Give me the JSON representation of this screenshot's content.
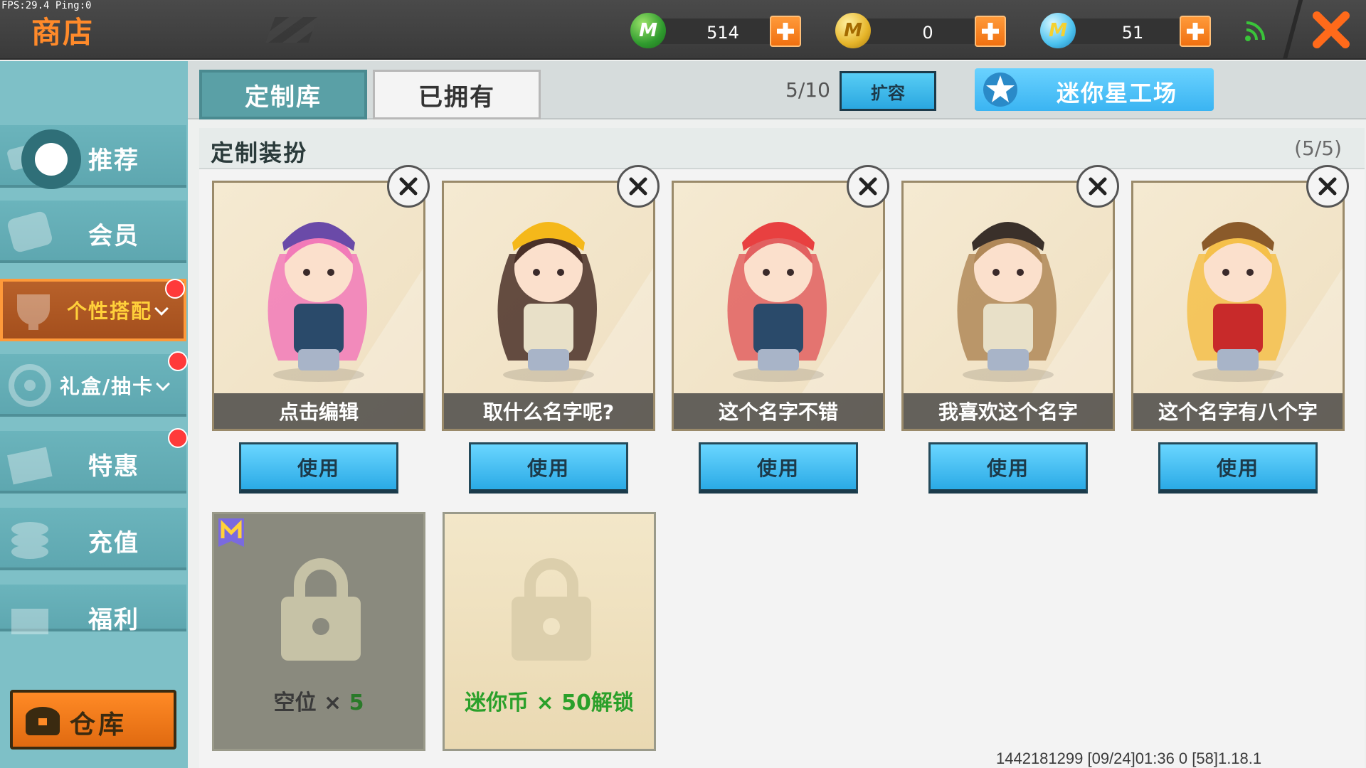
{
  "status": {
    "fps_text": "FPS:29.4  Ping:0"
  },
  "header": {
    "title": "商店",
    "currencies": [
      {
        "icon": "green-mini-bean-icon",
        "value": "514"
      },
      {
        "icon": "gold-coin-icon",
        "value": "0"
      },
      {
        "icon": "blue-mini-coin-icon",
        "value": "51"
      }
    ]
  },
  "sidebar": {
    "items": [
      {
        "label": "推荐",
        "icon": "recommend-icon"
      },
      {
        "label": "会员",
        "icon": "member-icon"
      },
      {
        "label": "个性搭配",
        "icon": "trophy-icon",
        "active": true,
        "badge": true
      },
      {
        "label": "礼盒/抽卡",
        "icon": "gift-wheel-icon",
        "badge": true
      },
      {
        "label": "特惠",
        "icon": "gift-box-icon",
        "badge": true
      },
      {
        "label": "充值",
        "icon": "coins-icon"
      },
      {
        "label": "福利",
        "icon": "present-icon"
      }
    ],
    "warehouse": {
      "label": "仓库",
      "icon": "chest-icon"
    }
  },
  "tabs": [
    {
      "label": "定制库",
      "active": true
    },
    {
      "label": "已拥有",
      "active": false
    }
  ],
  "toolbar": {
    "capacity": "5/10",
    "expand_label": "扩容",
    "workshop_label": "迷你星工场"
  },
  "panel": {
    "title": "定制装扮",
    "count": "(5/5)",
    "outfits": [
      {
        "name": "点击编辑",
        "use_label": "使用",
        "hair": "#f27ab8",
        "hat": "#6a4aa8",
        "body": "#2a4a6a"
      },
      {
        "name": "取什么名字呢?",
        "use_label": "使用",
        "hair": "#4a3028",
        "hat": "#f5b81a",
        "body": "#e8e0c8"
      },
      {
        "name": "这个名字不错",
        "use_label": "使用",
        "hair": "#e26060",
        "hat": "#e84040",
        "body": "#2a4a6a"
      },
      {
        "name": "我喜欢这个名字",
        "use_label": "使用",
        "hair": "#b08858",
        "hat": "#3a302a",
        "body": "#e8e0c8"
      },
      {
        "name": "这个名字有八个字",
        "use_label": "使用",
        "hair": "#f5c04a",
        "hat": "#8a5a2a",
        "body": "#c82a2a"
      }
    ],
    "empty_slot": {
      "label_prefix": "空位 × ",
      "label_num": "5"
    },
    "coin_slot": {
      "label": "迷你币 × 50解锁"
    }
  },
  "footer": {
    "info": "1442181299    [09/24]01:36 0  [58]1.18.1"
  },
  "colors": {
    "accent_orange": "#ff8a2a",
    "tab_teal": "#5aa0a6",
    "use_blue": "#2aaae6"
  }
}
